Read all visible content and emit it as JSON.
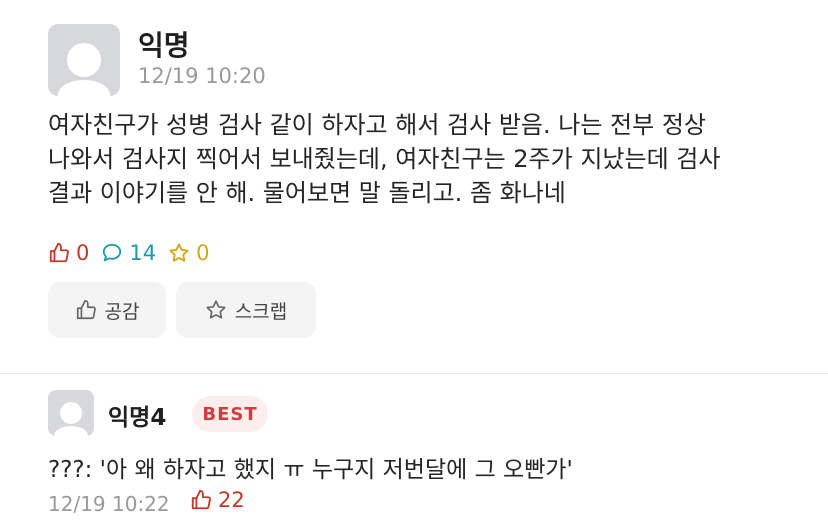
{
  "post": {
    "author": "익명",
    "time": "12/19 10:20",
    "body_lines": [
      "여자친구가 성병 검사 같이 하자고 해서 검사 받음. 나는 전부 정상",
      "나와서 검사지 찍어서 보내줬는데, 여자친구는 2주가 지났는데 검사",
      "결과 이야기를 안 해. 물어보면 말 돌리고. 좀 화나네"
    ],
    "stats": {
      "likes": "0",
      "comments": "14",
      "scraps": "0"
    },
    "buttons": {
      "like_label": "공감",
      "scrap_label": "스크랩"
    }
  },
  "comment": {
    "author": "익명4",
    "badge": "BEST",
    "body": "???: '아 왜 하자고 했지 ㅠ 누구지 저번달에 그 오빤가'",
    "time": "12/19 10:22",
    "likes": "22"
  },
  "colors": {
    "like": "#c0392b",
    "comment": "#1a9bb0",
    "scrap": "#d6a51a",
    "best_text": "#d23c3c",
    "best_bg": "#fdeeee"
  },
  "icons": [
    "avatar-placeholder",
    "thumbs-up-icon",
    "comment-bubble-icon",
    "star-icon"
  ]
}
